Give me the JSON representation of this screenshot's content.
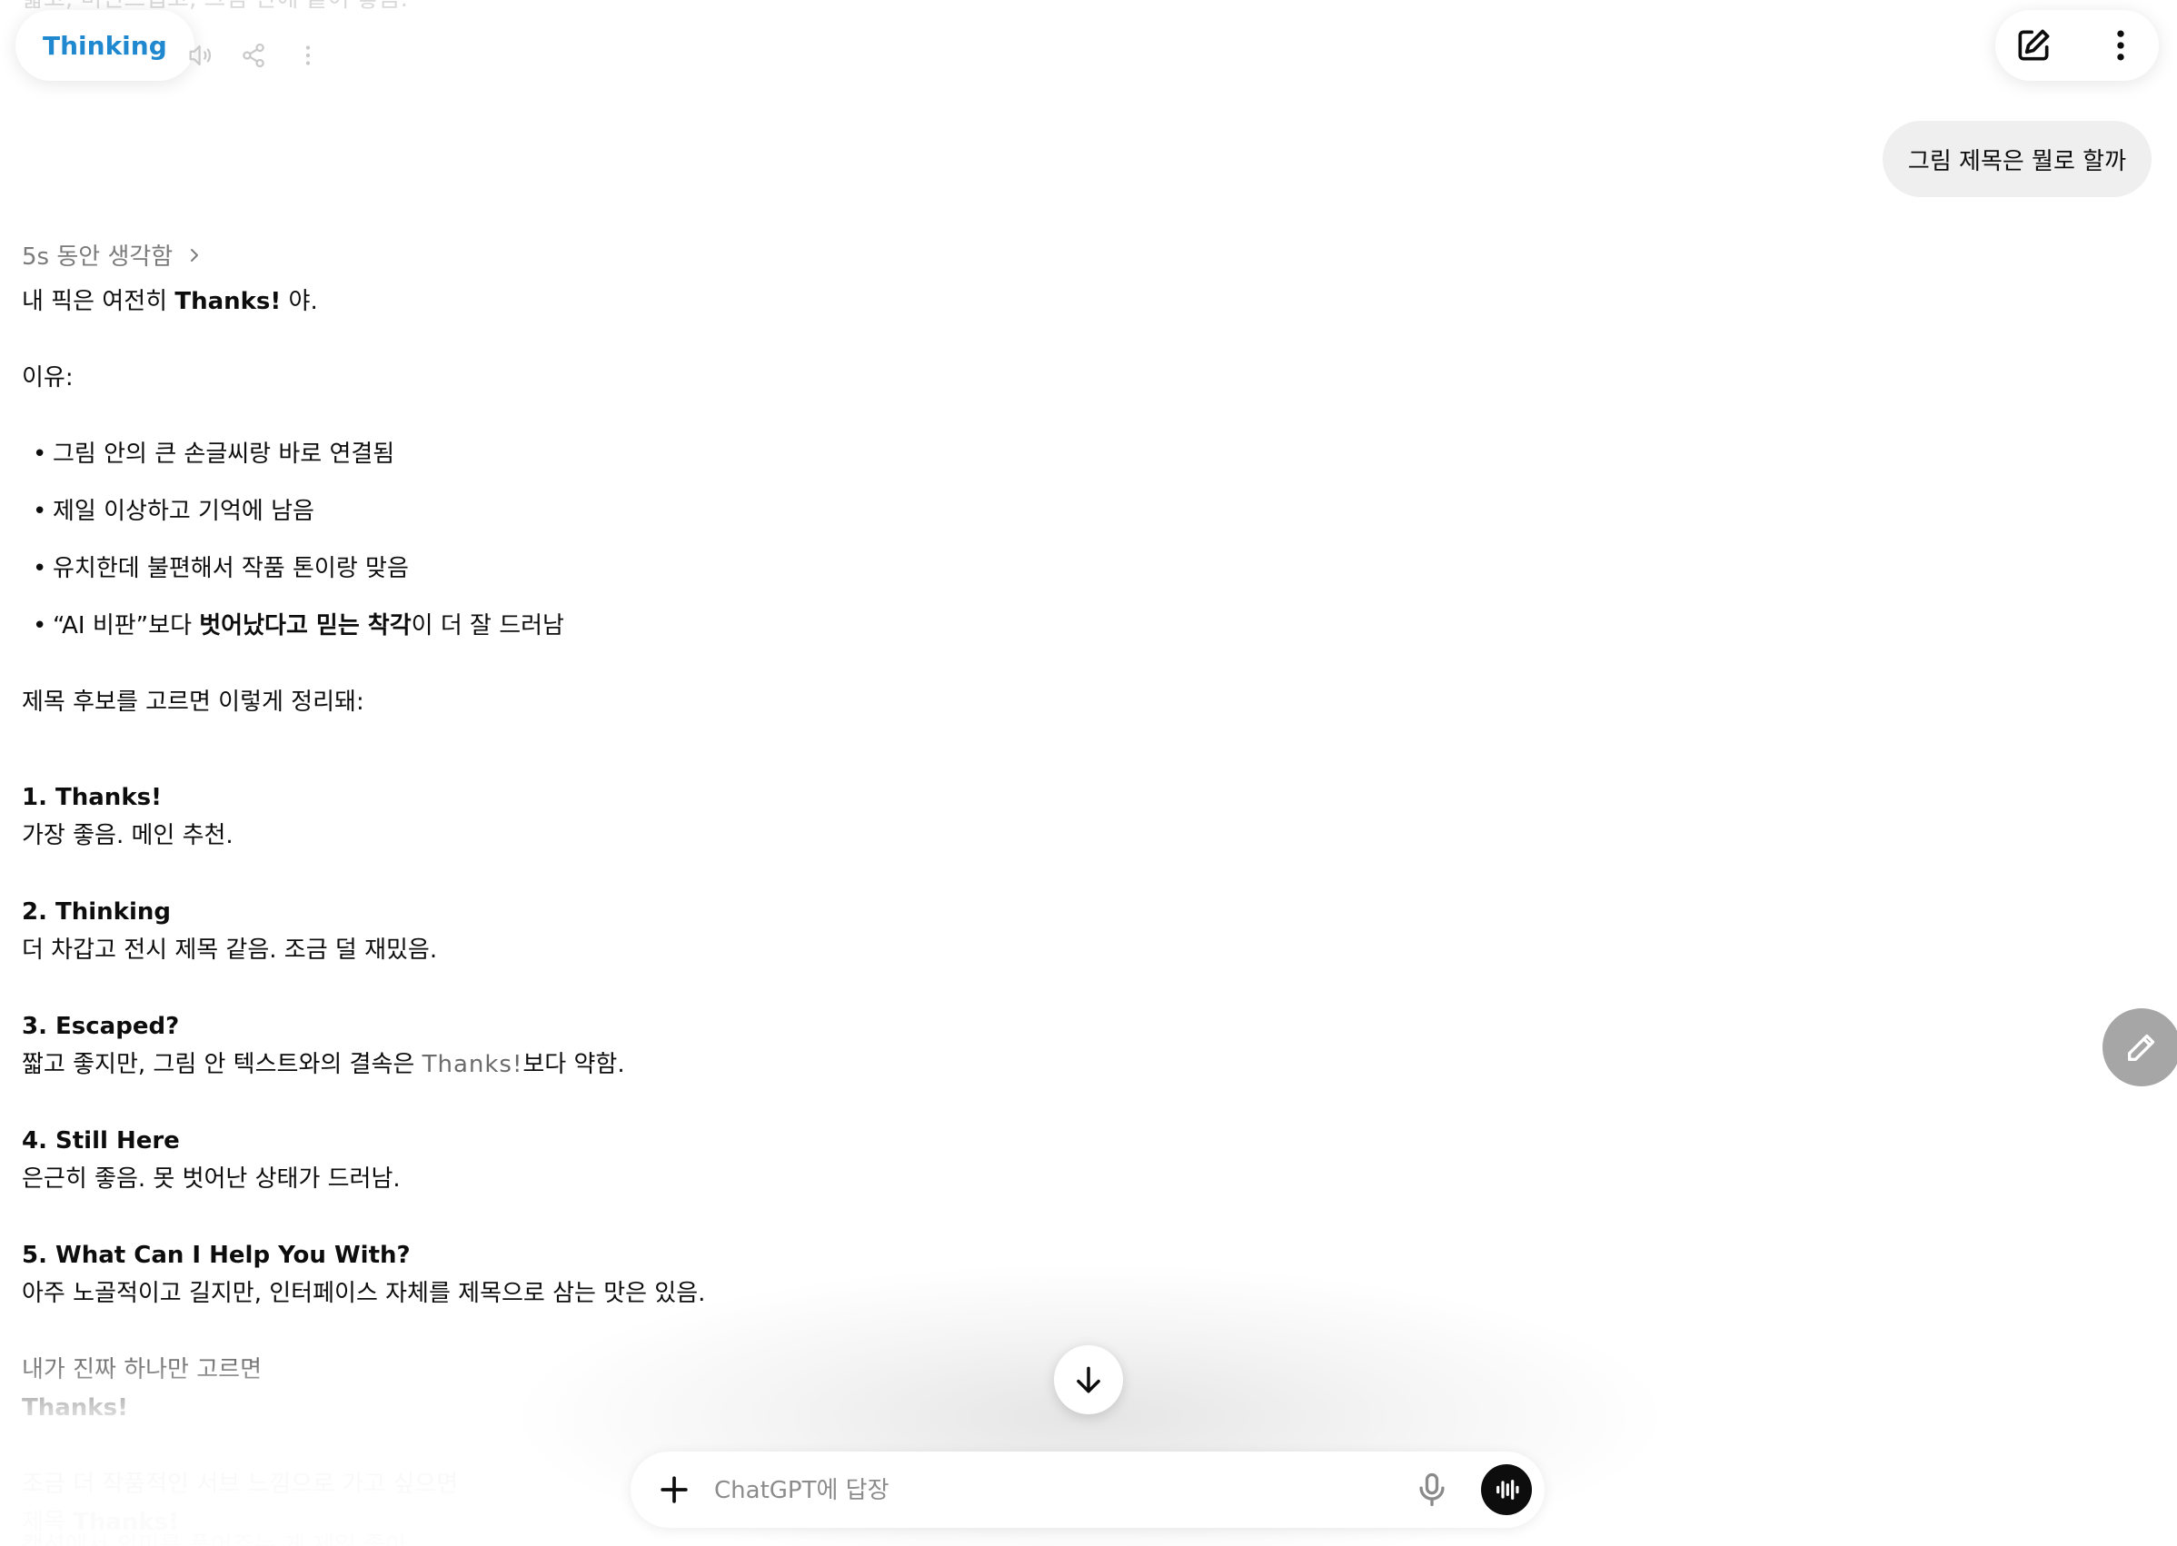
{
  "header": {
    "cutoff_text": "짧고, 미친스럽고, 그림 안에 붙어 좋음.",
    "title": "Thinking"
  },
  "user_message": "그림 제목은 뭘로 할까",
  "thought_label": "5s 동안 생각함",
  "response": {
    "intro_pre": "내 픽은 여전히 ",
    "intro_bold": "Thanks!",
    "intro_post": " 야.",
    "reasons_label": "이유:",
    "bullets": [
      "그림 안의 큰 손글씨랑 바로 연결됨",
      "제일 이상하고 기억에 남음",
      "유치한데 불편해서 작품 톤이랑 맞음"
    ],
    "bullet4_pre": "“AI 비판”보다 ",
    "bullet4_bold": "벗어났다고 믿는 착각",
    "bullet4_post": "이 더 잘 드러남",
    "candidates_label": "제목 후보를 고르면 이렇게 정리돼:",
    "items": [
      {
        "title": "1. Thanks!",
        "desc": "가장 좋음. 메인 추천."
      },
      {
        "title": "2. Thinking",
        "desc": "더 차갑고 전시 제목 같음. 조금 덜 재밌음."
      },
      {
        "title": "3. Escaped?",
        "desc_pre": "짧고 좋지만, 그림 안 텍스트와의 결속은 ",
        "desc_code": "Thanks!",
        "desc_post": "보다 약함."
      },
      {
        "title": "4. Still Here",
        "desc": "은근히 좋음. 못 벗어난 상태가 드러남."
      },
      {
        "title": "5. What Can I Help You With?",
        "desc": "아주 노골적이고 길지만, 인터페이스 자체를 제목으로 삼는 맛은 있음."
      }
    ],
    "pick_label": "내가 진짜 하나만 고르면",
    "pick_value": "Thanks!",
    "fade_line1": "조금 더 작품적인 서브 느낌으로 가고 싶으면",
    "fade_line2_pre": "제목 ",
    "fade_line2_bold": "Thanks!",
    "fade_line3": "캡션에서 의미를 풀어주는 게 제일 좋아"
  },
  "composer": {
    "placeholder": "ChatGPT에 답장"
  },
  "icons": {
    "speaker": "speaker-icon",
    "share": "share-icon",
    "more": "more-vertical-icon",
    "new_chat": "new-chat-icon",
    "pencil": "pencil-icon",
    "arrow_down": "arrow-down-icon",
    "plus": "plus-icon",
    "mic": "mic-icon",
    "voice": "voice-waveform-icon"
  }
}
